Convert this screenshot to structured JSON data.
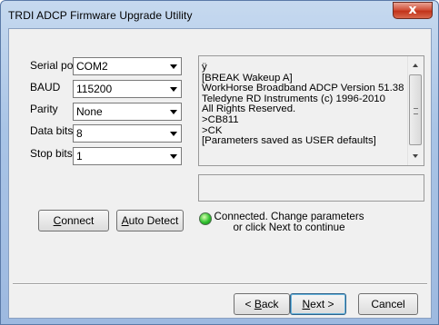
{
  "window": {
    "title": "TRDI ADCP Firmware Upgrade Utility",
    "close_glyph": "x"
  },
  "form": {
    "serial_port": {
      "label": "Serial port",
      "value": "COM2"
    },
    "baud": {
      "label": "BAUD",
      "value": "115200"
    },
    "parity": {
      "label": "Parity",
      "value": "None"
    },
    "data_bits": {
      "label": "Data bits",
      "value": "8"
    },
    "stop_bits": {
      "label": "Stop bits",
      "value": "1"
    }
  },
  "buttons": {
    "connect": {
      "mnemonic": "C",
      "rest": "onnect"
    },
    "auto_detect": {
      "mnemonic": "A",
      "rest": "uto Detect"
    },
    "back": {
      "prefix": "< ",
      "mnemonic": "B",
      "rest": "ack"
    },
    "next": {
      "mnemonic": "N",
      "rest": "ext >"
    },
    "cancel": {
      "label": "Cancel"
    }
  },
  "log": {
    "lines": [
      "ÿ",
      "[BREAK Wakeup A]",
      "WorkHorse Broadband ADCP Version 51.38",
      "Teledyne RD Instruments (c) 1996-2010",
      "All Rights Reserved.",
      ">CB811",
      ">CK",
      "[Parameters saved as USER defaults]"
    ]
  },
  "status": {
    "message_line1": "Connected. Change parameters",
    "message_line2": "or click Next to continue",
    "led_color": "#2fc12f"
  }
}
